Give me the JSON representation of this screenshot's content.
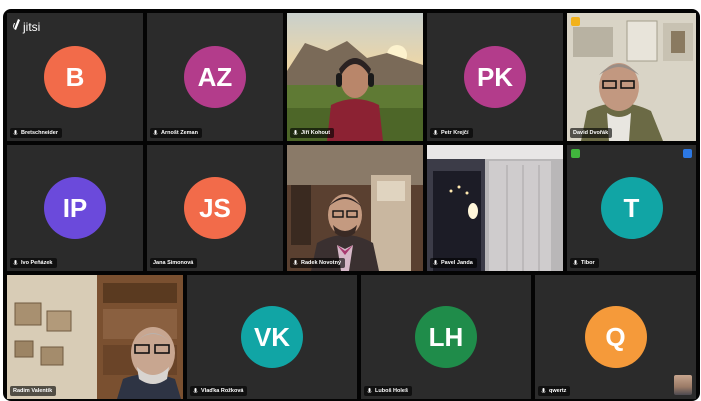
{
  "app": {
    "logo_text": "jitsi"
  },
  "tiles": [
    {
      "name": "Bretschneider",
      "initials": "B",
      "color": "#f26b4a",
      "type": "avatar"
    },
    {
      "name": "Arnošt Zeman",
      "initials": "AZ",
      "color": "#b33c8b",
      "type": "avatar"
    },
    {
      "name": "Jiří Kohout",
      "type": "video"
    },
    {
      "name": "Petr Krejčí",
      "initials": "PK",
      "color": "#b33c8b",
      "type": "avatar"
    },
    {
      "name": "David Dvořák",
      "type": "video"
    },
    {
      "name": "Ivo Peňázek",
      "initials": "IP",
      "color": "#6b4adb",
      "type": "avatar"
    },
    {
      "name": "Jana Simonová",
      "initials": "JS",
      "color": "#f26b4a",
      "type": "avatar"
    },
    {
      "name": "Radek Novotný",
      "type": "video"
    },
    {
      "name": "Pavel Janda",
      "type": "video"
    },
    {
      "name": "Tibor",
      "initials": "T",
      "color": "#11a5a5",
      "type": "avatar"
    },
    {
      "name": "Radim Valentík",
      "type": "video"
    },
    {
      "name": "Vlaďka Rožková",
      "initials": "VK",
      "color": "#11a5a5",
      "type": "avatar"
    },
    {
      "name": "Luboš Holeš",
      "initials": "LH",
      "color": "#1f8c4a",
      "type": "avatar"
    },
    {
      "name": "qwertz",
      "initials": "Q",
      "color": "#f59a3a",
      "type": "avatar"
    }
  ],
  "colors": {
    "background": "#040404",
    "tile": "#2b2b2b",
    "active_border": "#4a90d9"
  },
  "icons": [
    "jitsi-logo-icon",
    "mic-icon",
    "raised-hand-icon",
    "connection-icon"
  ]
}
